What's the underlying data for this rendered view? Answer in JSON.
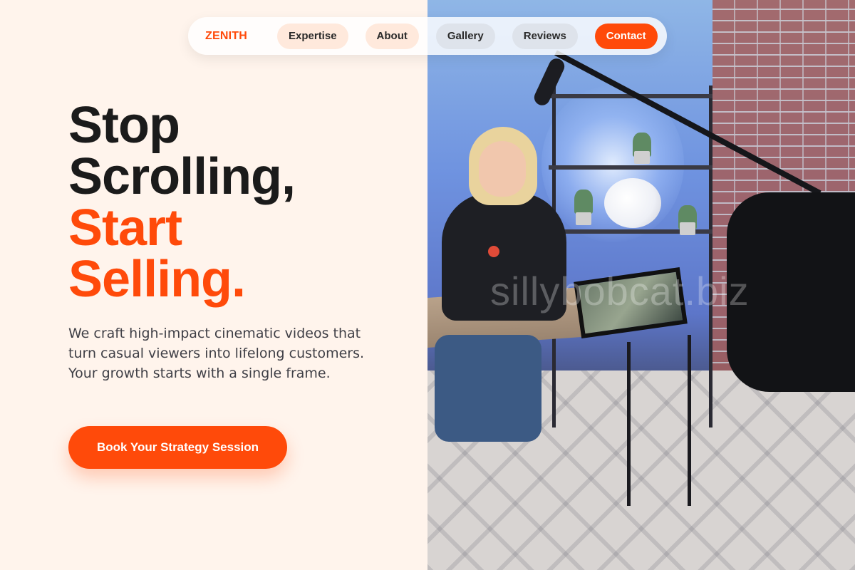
{
  "nav": {
    "logo": "ZENITH",
    "links": [
      {
        "label": "Expertise"
      },
      {
        "label": "About"
      },
      {
        "label": "Gallery"
      },
      {
        "label": "Reviews"
      }
    ],
    "contact_label": "Contact"
  },
  "hero": {
    "headline_line1": "Stop",
    "headline_line2": "Scrolling,",
    "headline_accent1": "Start",
    "headline_accent2": "Selling.",
    "lede": "We craft high-impact cinematic videos that turn casual viewers into lifelong customers. Your growth starts with a single frame.",
    "cta_label": "Book Your Strategy Session"
  },
  "photo": {
    "watermark": "sillybobcat.biz"
  },
  "colors": {
    "accent": "#ff4a0a",
    "background": "#fff4ec",
    "headline": "#1b1b1b",
    "body_text": "#3f3f46"
  }
}
